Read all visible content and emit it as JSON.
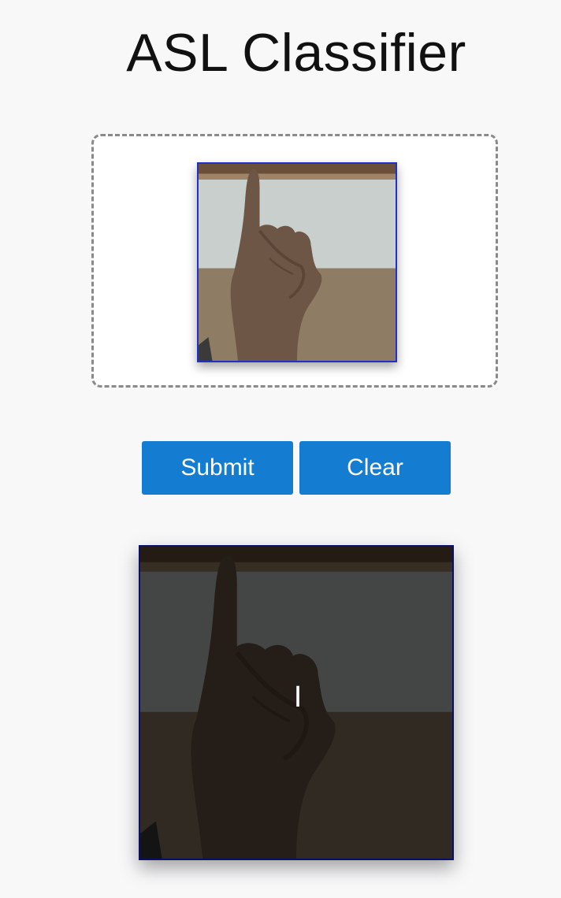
{
  "header": {
    "title": "ASL Classifier"
  },
  "upload": {
    "image_alt": "uploaded hand sign photo"
  },
  "actions": {
    "submit_label": "Submit",
    "clear_label": "Clear"
  },
  "result": {
    "prediction": "I"
  },
  "colors": {
    "button": "#147dd2",
    "thumb_border": "#2030c8",
    "result_border": "#0a0f6a",
    "background": "#f8f8f9"
  }
}
